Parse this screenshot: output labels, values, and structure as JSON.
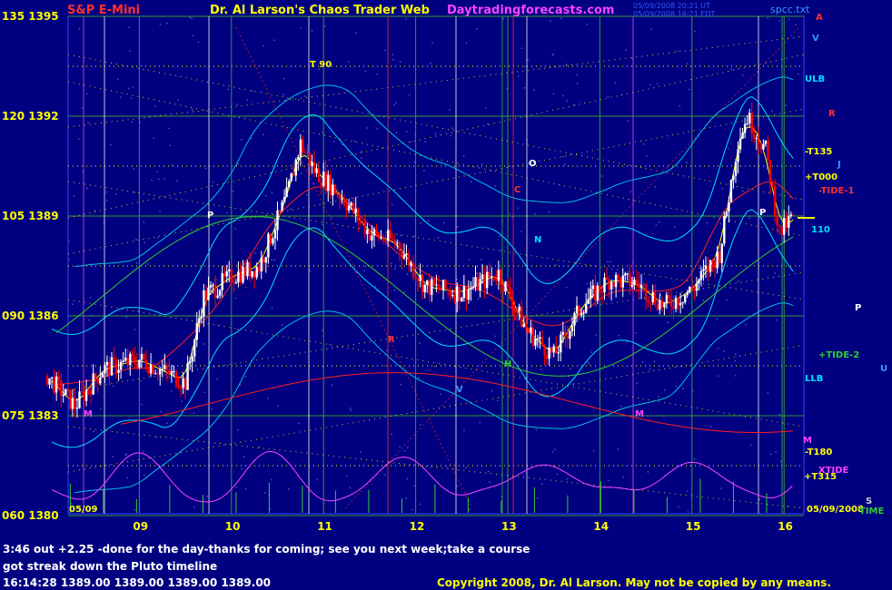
{
  "header": {
    "symbol": "S&P E-Mini",
    "title": "Dr. Al Larson's Chaos Trader Web",
    "site": "Daytradingforecasts.com",
    "timestamp1": "05/09/2008 20:21 UT",
    "timestamp2": "05/09/2008 16:21 EDT",
    "file": "spcc.txt"
  },
  "colors": {
    "background": "#000080",
    "axis_yellow": "#ffff00",
    "symbol_red": "#ff3030",
    "site_magenta": "#ff44ff",
    "upbar": "#ffffff",
    "downbar": "#ff0000",
    "bands": "#00e0ff",
    "tide_green": "#33cc33",
    "ltide_red": "#ff2020",
    "xtide_magenta": "#ff44ff"
  },
  "chart_data": {
    "type": "candlestick",
    "y_labels": [
      {
        "field": "135",
        "price": "1395"
      },
      {
        "field": "120",
        "price": "1392"
      },
      {
        "field": "105",
        "price": "1389"
      },
      {
        "field": "090",
        "price": "1386"
      },
      {
        "field": "075",
        "price": "1383"
      },
      {
        "field": "060",
        "price": "1380"
      }
    ],
    "ylim": [
      1380,
      1395
    ],
    "x_labels": [
      "09",
      "10",
      "11",
      "12",
      "13",
      "14",
      "15",
      "16"
    ],
    "date_left": "05/09",
    "date_right": "05/09/2008",
    "time_label": "TIME",
    "ohlc_anchors": [
      [
        8.0,
        1384.2
      ],
      [
        8.3,
        1383.3
      ],
      [
        8.6,
        1384.4
      ],
      [
        9.0,
        1384.7
      ],
      [
        9.3,
        1384.3
      ],
      [
        9.5,
        1384.0
      ],
      [
        9.7,
        1386.6
      ],
      [
        10.0,
        1387.2
      ],
      [
        10.3,
        1387.5
      ],
      [
        10.6,
        1389.6
      ],
      [
        10.75,
        1391.2
      ],
      [
        10.9,
        1390.4
      ],
      [
        11.2,
        1389.6
      ],
      [
        11.5,
        1388.5
      ],
      [
        11.8,
        1388.2
      ],
      [
        12.1,
        1386.9
      ],
      [
        12.5,
        1386.7
      ],
      [
        12.9,
        1387.3
      ],
      [
        13.2,
        1385.6
      ],
      [
        13.5,
        1384.8
      ],
      [
        13.8,
        1386.3
      ],
      [
        14.1,
        1387.1
      ],
      [
        14.4,
        1387.0
      ],
      [
        14.7,
        1386.3
      ],
      [
        15.0,
        1386.8
      ],
      [
        15.3,
        1387.9
      ],
      [
        15.5,
        1391.3
      ],
      [
        15.6,
        1392.0
      ],
      [
        15.8,
        1391.0
      ],
      [
        15.95,
        1388.5
      ],
      [
        16.1,
        1389.0
      ],
      [
        16.15,
        1389.0
      ]
    ],
    "right_labels": [
      {
        "text": "A",
        "color": "#ff3030"
      },
      {
        "text": "V",
        "color": "#3399ff"
      },
      {
        "text": "ULB",
        "color": "#00e0ff"
      },
      {
        "text": "R",
        "color": "#ff3030"
      },
      {
        "text": "-T135",
        "color": "#ffff00"
      },
      {
        "text": "J",
        "color": "#3399ff"
      },
      {
        "text": "+T000",
        "color": "#ffff00"
      },
      {
        "text": "-TIDE-1",
        "color": "#ff3030"
      },
      {
        "text": "110",
        "color": "#00e0ff"
      },
      {
        "text": "P",
        "color": "#ffffff"
      },
      {
        "text": "+TIDE-2",
        "color": "#33cc33"
      },
      {
        "text": "U",
        "color": "#3399ff"
      },
      {
        "text": "LLB",
        "color": "#00e0ff"
      },
      {
        "text": "M",
        "color": "#ff44ff"
      },
      {
        "text": "-T180",
        "color": "#ffff00"
      },
      {
        "text": "XTIDE",
        "color": "#ff44ff"
      },
      {
        "text": "+T315",
        "color": "#ffff00"
      },
      {
        "text": "S",
        "color": "#cccccc"
      }
    ],
    "marker_labels": [
      {
        "text": "T 90",
        "color": "#ffff00"
      },
      {
        "text": "P",
        "color": "#ffffff"
      },
      {
        "text": "O",
        "color": "#ffffff"
      },
      {
        "text": "C",
        "color": "#ff3030"
      },
      {
        "text": "N",
        "color": "#00e0ff"
      },
      {
        "text": "H",
        "color": "#33cc33"
      },
      {
        "text": "V",
        "color": "#3399ff"
      },
      {
        "text": "M",
        "color": "#ff44ff"
      },
      {
        "text": "R",
        "color": "#ff3030"
      },
      {
        "text": "P",
        "color": "#ffffff"
      },
      {
        "text": "M",
        "color": "#ff44ff"
      }
    ]
  },
  "messages": {
    "line1": "3:46 out +2.25 -done for the day-thanks for coming; see you next week;take a course",
    "line2": "got streak down the Pluto timeline",
    "quote": "16:14:28  1389.00 1389.00 1389.00 1389.00",
    "copyright": "Copyright 2008, Dr. Al Larson. May not be copied by any means."
  }
}
